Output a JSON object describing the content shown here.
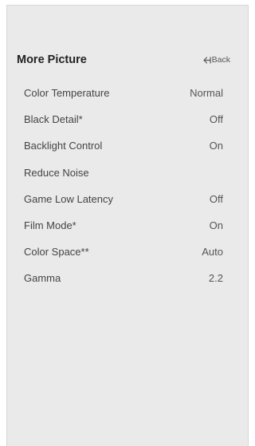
{
  "header": {
    "title": "More Picture",
    "back_label": "Back"
  },
  "menu": {
    "items": [
      {
        "label": "Color Temperature",
        "value": "Normal"
      },
      {
        "label": "Black Detail*",
        "value": "Off"
      },
      {
        "label": "Backlight Control",
        "value": "On"
      },
      {
        "label": "Reduce Noise",
        "value": ""
      },
      {
        "label": "Game Low Latency",
        "value": "Off"
      },
      {
        "label": "Film Mode*",
        "value": "On"
      },
      {
        "label": "Color Space**",
        "value": "Auto"
      },
      {
        "label": "Gamma",
        "value": "2.2"
      }
    ]
  },
  "icons": {
    "back": "back-arrow-icon"
  },
  "colors": {
    "panel_background": "#eaeaea",
    "title_text": "#222222",
    "item_text": "#444444"
  }
}
